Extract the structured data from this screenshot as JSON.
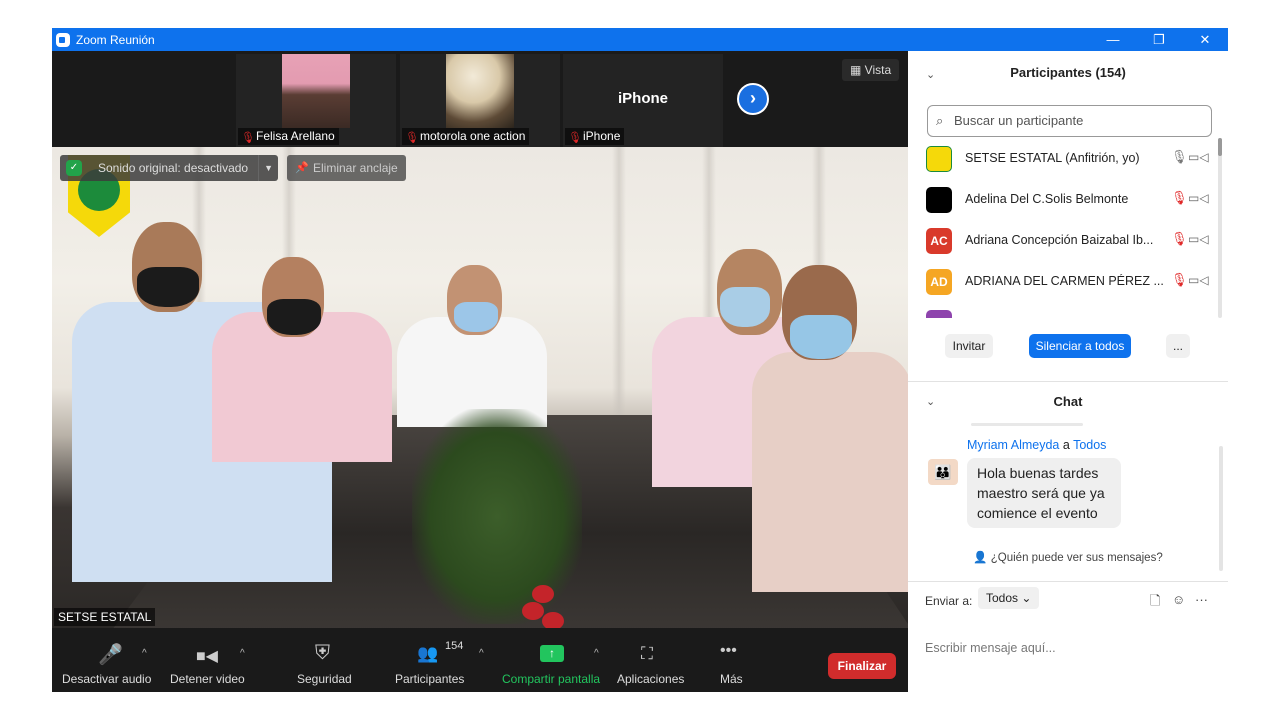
{
  "window": {
    "title": "Zoom Reunión",
    "controls": [
      "—",
      "❐",
      "✕"
    ]
  },
  "strip": {
    "thumbs": [
      {
        "name": "Felisa Arellano",
        "has_video": true
      },
      {
        "name": "motorola one action",
        "has_video": true
      },
      {
        "name": "iPhone",
        "has_video": false,
        "big_name": "iPhone"
      }
    ],
    "next_label": "›",
    "vista_label": "Vista"
  },
  "main": {
    "sonido_label": "Sonido original: desactivado",
    "eliminar_label": "Eliminar anclaje",
    "speaker_name": "SETSE ESTATAL"
  },
  "toolbar": {
    "buttons": [
      {
        "label": "Desactivar audio",
        "icon": "microphone-icon"
      },
      {
        "label": "Detener video",
        "icon": "video-camera-icon"
      },
      {
        "label": "Seguridad",
        "icon": "shield-icon"
      },
      {
        "label": "Participantes",
        "icon": "participants-icon",
        "count": "154"
      },
      {
        "label": "Compartir pantalla",
        "icon": "share-screen-icon"
      },
      {
        "label": "Aplicaciones",
        "icon": "apps-icon"
      },
      {
        "label": "Más",
        "icon": "more-icon"
      }
    ],
    "end_label": "Finalizar"
  },
  "participants": {
    "title": "Participantes (154)",
    "search_placeholder": "Buscar un participante",
    "list": [
      {
        "name": "SETSE ESTATAL (Anfitrión, yo)",
        "initials": "",
        "color": "#f5d90a",
        "muted": false
      },
      {
        "name": "Adelina Del C.Solis Belmonte",
        "initials": "",
        "color": "#000000",
        "muted": true
      },
      {
        "name": "Adriana Concepción Baizabal Ib...",
        "initials": "AC",
        "color": "#d93a2b",
        "muted": true
      },
      {
        "name": "ADRIANA DEL CARMEN PÉREZ ...",
        "initials": "AD",
        "color": "#f5a623",
        "muted": true
      }
    ],
    "buttons": {
      "invite": "Invitar",
      "mute_all": "Silenciar a todos",
      "more": "..."
    }
  },
  "chat": {
    "title": "Chat",
    "message": {
      "from": "Myriam Almeyda",
      "to_sep": "a",
      "to": "Todos",
      "text": "Hola buenas tardes maestro será que ya comience el evento"
    },
    "who_can_see": "¿Quién puede ver sus mensajes?",
    "send_to_label": "Enviar a:",
    "send_to_value": "Todos",
    "input_placeholder": "Escribir mensaje aquí..."
  },
  "colors": {
    "zoom_blue": "#0e72ed",
    "end_red": "#d12c2c",
    "share_green": "#22c55e"
  }
}
